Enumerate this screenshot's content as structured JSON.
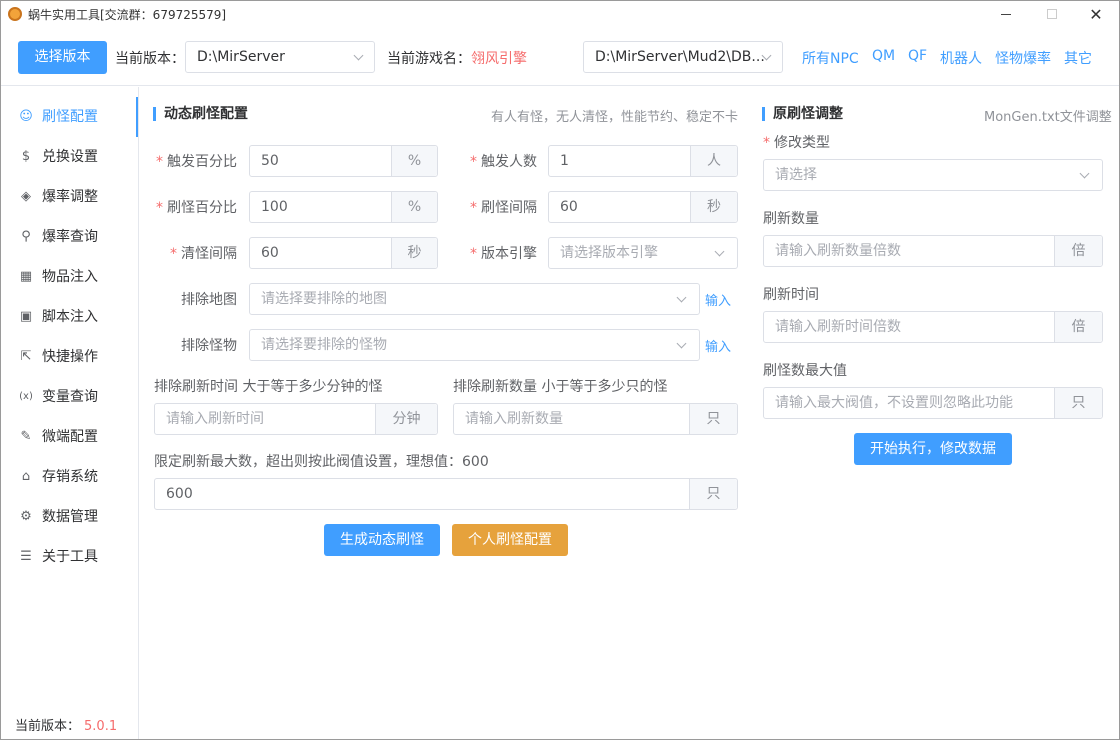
{
  "window": {
    "title": "蜗牛实用工具[交流群：679725579]",
    "controls": [
      "minimize",
      "maximize",
      "close"
    ]
  },
  "toolbar": {
    "choose_version_button": "选择版本",
    "current_version_label": "当前版本：",
    "current_version_value": "D:\\MirServer",
    "game_name_label": "当前游戏名：",
    "game_name_value": "翎风引擎",
    "db_path_value": "D:\\MirServer\\Mud2\\DB...",
    "links": [
      "所有NPC",
      "QM",
      "QF",
      "机器人",
      "怪物爆率",
      "其它"
    ]
  },
  "sidebar": {
    "items": [
      {
        "label": "刷怪配置",
        "icon": "monster-icon",
        "active": true
      },
      {
        "label": "兑换设置",
        "icon": "coin-icon",
        "active": false
      },
      {
        "label": "爆率调整",
        "icon": "box-icon",
        "active": false
      },
      {
        "label": "爆率查询",
        "icon": "search-icon",
        "active": false
      },
      {
        "label": "物品注入",
        "icon": "grid-icon",
        "active": false
      },
      {
        "label": "脚本注入",
        "icon": "script-icon",
        "active": false
      },
      {
        "label": "快捷操作",
        "icon": "external-icon",
        "active": false
      },
      {
        "label": "变量查询",
        "icon": "variable-icon",
        "active": false
      },
      {
        "label": "微端配置",
        "icon": "gear-icon",
        "active": false
      },
      {
        "label": "存销系统",
        "icon": "store-icon",
        "active": false
      },
      {
        "label": "数据管理",
        "icon": "settings-icon",
        "active": false
      },
      {
        "label": "关于工具",
        "icon": "document-icon",
        "active": false
      }
    ],
    "version_label": "当前版本：",
    "version_value": "5.0.1"
  },
  "dynamic": {
    "title": "动态刷怪配置",
    "hint": "有人有怪，无人清怪，性能节约、稳定不卡",
    "trigger_percent": {
      "label": "触发百分比",
      "value": "50",
      "unit": "%"
    },
    "trigger_people": {
      "label": "触发人数",
      "value": "1",
      "unit": "人"
    },
    "spawn_percent": {
      "label": "刷怪百分比",
      "value": "100",
      "unit": "%"
    },
    "spawn_interval": {
      "label": "刷怪间隔",
      "value": "60",
      "unit": "秒"
    },
    "clear_interval": {
      "label": "清怪间隔",
      "value": "60",
      "unit": "秒"
    },
    "engine": {
      "label": "版本引擎",
      "placeholder": "请选择版本引擎"
    },
    "exclude_map": {
      "label": "排除地图",
      "placeholder": "请选择要排除的地图",
      "link": "输入"
    },
    "exclude_monster": {
      "label": "排除怪物",
      "placeholder": "请选择要排除的怪物",
      "link": "输入"
    },
    "exclude_time": {
      "label": "排除刷新时间 大于等于多少分钟的怪",
      "placeholder": "请输入刷新时间",
      "unit": "分钟"
    },
    "exclude_count": {
      "label": "排除刷新数量 小于等于多少只的怪",
      "placeholder": "请输入刷新数量",
      "unit": "只"
    },
    "max_limit": {
      "label": "限定刷新最大数，超出则按此阀值设置，理想值：600",
      "value": "600",
      "unit": "只"
    },
    "generate_button": "生成动态刷怪",
    "personal_button": "个人刷怪配置"
  },
  "original": {
    "title": "原刷怪调整",
    "hint": "MonGen.txt文件调整",
    "modify_type": {
      "label": "修改类型",
      "placeholder": "请选择"
    },
    "refresh_count": {
      "label": "刷新数量",
      "placeholder": "请输入刷新数量倍数",
      "unit": "倍"
    },
    "refresh_time": {
      "label": "刷新时间",
      "placeholder": "请输入刷新时间倍数",
      "unit": "倍"
    },
    "max_value": {
      "label": "刷怪数最大值",
      "placeholder": "请输入最大阀值，不设置则忽略此功能",
      "unit": "只"
    },
    "execute_button": "开始执行，修改数据"
  },
  "colors": {
    "primary": "#409eff",
    "warning": "#e6a23c",
    "danger": "#f56c6c"
  }
}
